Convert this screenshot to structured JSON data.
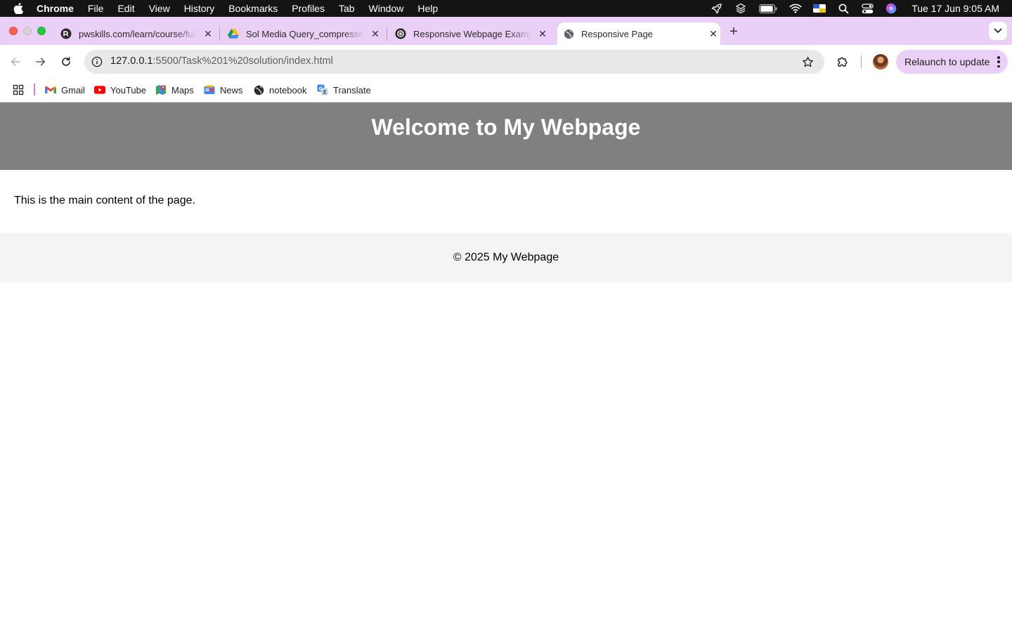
{
  "menubar": {
    "app_name": "Chrome",
    "menus": [
      "File",
      "Edit",
      "View",
      "History",
      "Bookmarks",
      "Profiles",
      "Tab",
      "Window",
      "Help"
    ],
    "clock": "Tue 17 Jun  9:05 AM"
  },
  "tabs": [
    {
      "title": "pwskills.com/learn/course/full",
      "favicon": "pwskills-icon"
    },
    {
      "title": "Sol Media Query_compressed",
      "favicon": "google-drive-icon"
    },
    {
      "title": "Responsive Webpage Example",
      "favicon": "chatgpt-icon"
    },
    {
      "title": "Responsive Page",
      "favicon": "globe-icon",
      "active": true
    }
  ],
  "toolbar": {
    "url_host": "127.0.0.1",
    "url_path": ":5500/Task%201%20solution/index.html",
    "relaunch_label": "Relaunch to update"
  },
  "bookmarks": [
    {
      "label": "Gmail",
      "icon": "gmail-icon"
    },
    {
      "label": "YouTube",
      "icon": "youtube-icon"
    },
    {
      "label": "Maps",
      "icon": "maps-icon"
    },
    {
      "label": "News",
      "icon": "news-icon"
    },
    {
      "label": "notebook",
      "icon": "globe-icon"
    },
    {
      "label": "Translate",
      "icon": "translate-icon"
    }
  ],
  "page": {
    "header_title": "Welcome to My Webpage",
    "main_text": "This is the main content of the page.",
    "footer_text": "© 2025 My Webpage"
  },
  "colors": {
    "header_bg": "#808080",
    "footer_bg": "#f4f4f4",
    "tabstrip_bg": "#ead0f6"
  }
}
